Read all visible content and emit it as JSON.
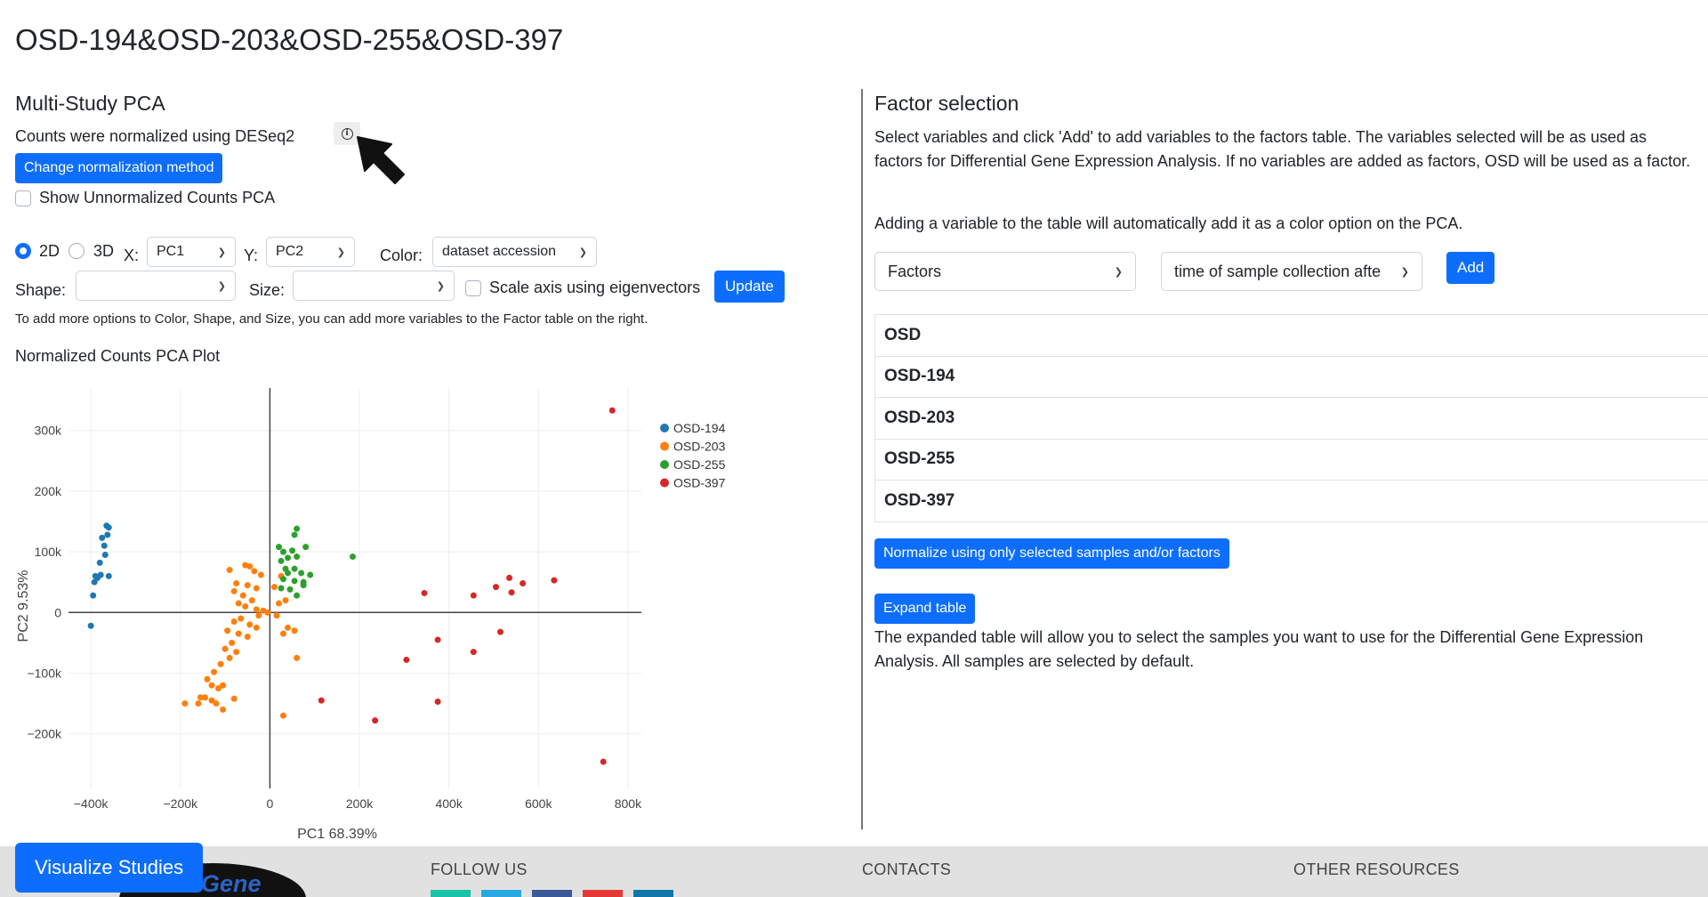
{
  "page_title": "OSD-194&OSD-203&OSD-255&OSD-397",
  "left": {
    "heading": "Multi-Study PCA",
    "normalization_text": "Counts were normalized using DESeq2",
    "change_norm_label": "Change normalization method",
    "show_unnormalized_label": "Show Unnormalized Counts PCA",
    "mode_2d": "2D",
    "mode_3d": "3D",
    "x_label": "X:",
    "x_value": "PC1",
    "y_label": "Y:",
    "y_value": "PC2",
    "color_label": "Color:",
    "color_value": "dataset accession",
    "shape_label": "Shape:",
    "size_label": "Size:",
    "scale_axis_label": "Scale axis using eigenvectors",
    "update_label": "Update",
    "hint": "To add more options to Color, Shape, and Size, you can add more variables to the Factor table on the right.",
    "plot_title": "Normalized Counts PCA Plot"
  },
  "chart_data": {
    "type": "scatter",
    "xlabel": "PC1 68.39%",
    "ylabel": "PC2 9.53%",
    "xlim": [
      -450000,
      830000
    ],
    "ylim": [
      -290000,
      370000
    ],
    "x_ticks": [
      -400000,
      -200000,
      0,
      200000,
      400000,
      600000,
      800000
    ],
    "x_tick_labels": [
      "−400k",
      "−200k",
      "0",
      "200k",
      "400k",
      "600k",
      "800k"
    ],
    "y_ticks": [
      300000,
      200000,
      100000,
      0,
      -100000,
      -200000
    ],
    "y_tick_labels": [
      "300k",
      "200k",
      "100k",
      "0",
      "−100k",
      "−200k"
    ],
    "legend_position": "top-right",
    "series": [
      {
        "name": "OSD-194",
        "color": "#1f77b4",
        "points": [
          [
            -400000,
            -22000
          ],
          [
            -365000,
            143000
          ],
          [
            -360000,
            140000
          ],
          [
            -363000,
            128000
          ],
          [
            -375000,
            123000
          ],
          [
            -370000,
            110000
          ],
          [
            -368000,
            95000
          ],
          [
            -380000,
            82000
          ],
          [
            -390000,
            60000
          ],
          [
            -385000,
            57000
          ],
          [
            -392000,
            50000
          ],
          [
            -378000,
            62000
          ],
          [
            -360000,
            60000
          ],
          [
            -395000,
            28000
          ]
        ]
      },
      {
        "name": "OSD-203",
        "color": "#ff7f0e",
        "points": [
          [
            -90000,
            70000
          ],
          [
            -55000,
            78000
          ],
          [
            -45000,
            76000
          ],
          [
            -35000,
            68000
          ],
          [
            -20000,
            62000
          ],
          [
            -75000,
            48000
          ],
          [
            -50000,
            45000
          ],
          [
            -30000,
            40000
          ],
          [
            -80000,
            35000
          ],
          [
            -60000,
            28000
          ],
          [
            -40000,
            20000
          ],
          [
            -70000,
            15000
          ],
          [
            -55000,
            10000
          ],
          [
            -30000,
            5000
          ],
          [
            -15000,
            3000
          ],
          [
            -5000,
            0
          ],
          [
            -25000,
            -5000
          ],
          [
            -65000,
            -10000
          ],
          [
            -80000,
            -15000
          ],
          [
            -45000,
            -20000
          ],
          [
            -30000,
            -25000
          ],
          [
            -95000,
            -30000
          ],
          [
            -70000,
            -35000
          ],
          [
            -50000,
            -40000
          ],
          [
            -85000,
            -50000
          ],
          [
            -100000,
            -60000
          ],
          [
            -75000,
            -65000
          ],
          [
            -90000,
            -75000
          ],
          [
            -110000,
            -85000
          ],
          [
            -125000,
            -98000
          ],
          [
            -140000,
            -110000
          ],
          [
            -105000,
            -120000
          ],
          [
            -130000,
            -120000
          ],
          [
            -115000,
            -125000
          ],
          [
            -145000,
            -140000
          ],
          [
            -160000,
            -150000
          ],
          [
            -130000,
            -145000
          ],
          [
            -190000,
            -150000
          ],
          [
            -105000,
            -160000
          ],
          [
            -120000,
            -150000
          ],
          [
            -80000,
            -142000
          ],
          [
            -155000,
            -140000
          ],
          [
            30000,
            -35000
          ],
          [
            40000,
            -25000
          ],
          [
            55000,
            -30000
          ],
          [
            60000,
            -75000
          ],
          [
            20000,
            15000
          ],
          [
            35000,
            20000
          ],
          [
            15000,
            -5000
          ],
          [
            30000,
            -170000
          ],
          [
            10000,
            42000
          ],
          [
            25000,
            60000
          ]
        ]
      },
      {
        "name": "OSD-255",
        "color": "#2ca02c",
        "points": [
          [
            20000,
            108000
          ],
          [
            30000,
            100000
          ],
          [
            50000,
            102000
          ],
          [
            55000,
            128000
          ],
          [
            60000,
            138000
          ],
          [
            80000,
            108000
          ],
          [
            40000,
            90000
          ],
          [
            60000,
            92000
          ],
          [
            25000,
            85000
          ],
          [
            35000,
            72000
          ],
          [
            55000,
            72000
          ],
          [
            70000,
            65000
          ],
          [
            90000,
            62000
          ],
          [
            30000,
            55000
          ],
          [
            55000,
            52000
          ],
          [
            75000,
            50000
          ],
          [
            25000,
            40000
          ],
          [
            45000,
            38000
          ],
          [
            60000,
            28000
          ],
          [
            185000,
            92000
          ],
          [
            75000,
            45000
          ],
          [
            40000,
            65000
          ]
        ]
      },
      {
        "name": "OSD-397",
        "color": "#d62728",
        "points": [
          [
            765000,
            333000
          ],
          [
            345000,
            32000
          ],
          [
            455000,
            28000
          ],
          [
            505000,
            42000
          ],
          [
            535000,
            57000
          ],
          [
            565000,
            48000
          ],
          [
            635000,
            53000
          ],
          [
            540000,
            33000
          ],
          [
            375000,
            -45000
          ],
          [
            455000,
            -65000
          ],
          [
            515000,
            -32000
          ],
          [
            305000,
            -78000
          ],
          [
            375000,
            -147000
          ],
          [
            115000,
            -145000
          ],
          [
            235000,
            -178000
          ],
          [
            745000,
            -246000
          ]
        ]
      }
    ]
  },
  "right": {
    "heading": "Factor selection",
    "desc1": "Select variables and click 'Add' to add variables to the factors table. The variables selected will be as used as factors for Differential Gene Expression Analysis. If no variables are added as factors, OSD will be used as a factor.",
    "desc2": "Adding a variable to the table will automatically add it as a color option on the PCA.",
    "factors_select": "Factors",
    "time_select": "time of sample collection afte",
    "add_label": "Add",
    "table_rows": [
      "OSD",
      "OSD-194",
      "OSD-203",
      "OSD-255",
      "OSD-397"
    ],
    "normalize_selected_label": "Normalize using only selected samples and/or factors",
    "expand_label": "Expand table",
    "desc3": "The expanded table will allow you to select the samples you want to use for the Differential Gene Expression Analysis. All samples are selected by default."
  },
  "footer": {
    "visualize_label": "Visualize Studies",
    "follow_us": "FOLLOW US",
    "contacts": "CONTACTS",
    "other_resources": "OTHER RESOURCES",
    "logo_text": "Gene",
    "social_colors": [
      "#19c3a8",
      "#29a9e1",
      "#3b5998",
      "#e53935",
      "#0e76a8"
    ]
  }
}
